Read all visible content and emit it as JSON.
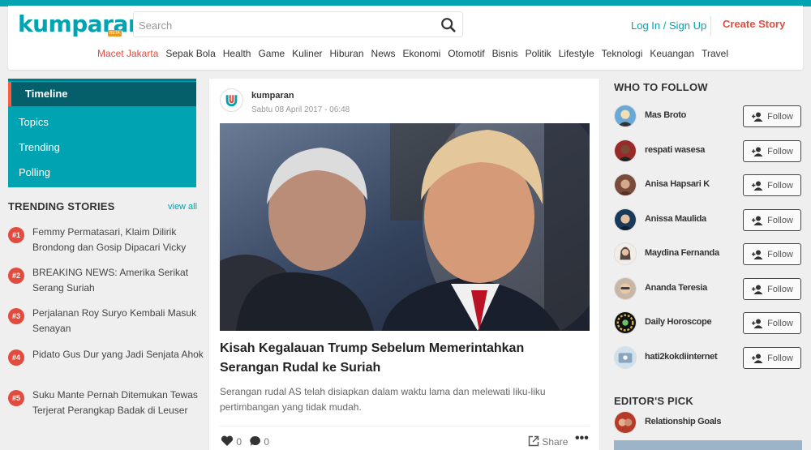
{
  "header": {
    "logo_text": "kumparan",
    "logo_badge": "BETA",
    "search_placeholder": "Search",
    "login_label": "Log In / Sign Up",
    "create_label": "Create Story",
    "categories": [
      "Macet Jakarta",
      "Sepak Bola",
      "Health",
      "Game",
      "Kuliner",
      "Hiburan",
      "News",
      "Ekonomi",
      "Otomotif",
      "Bisnis",
      "Politik",
      "Lifestyle",
      "Teknologi",
      "Keuangan",
      "Travel"
    ]
  },
  "sidebar": {
    "nav": [
      "Timeline",
      "Topics",
      "Trending",
      "Polling"
    ],
    "trending_title": "TRENDING STORIES",
    "view_all": "view all",
    "trending": [
      {
        "num": "#1",
        "text": "Femmy Permatasari, Klaim Dilirik Brondong dan Gosip Dipacari Vicky"
      },
      {
        "num": "#2",
        "text": "BREAKING NEWS: Amerika Serikat Serang Suriah"
      },
      {
        "num": "#3",
        "text": "Perjalanan Roy Suryo Kembali Masuk Senayan"
      },
      {
        "num": "#4",
        "text": "Pidato Gus Dur yang Jadi Senjata Ahok"
      },
      {
        "num": "#5",
        "text": "Suku Mante Pernah Ditemukan Tewas Terjerat Perangkap Badak di Leuser"
      }
    ]
  },
  "story": {
    "author": "kumparan",
    "date": "Sabtu 08 April 2017 - 06:48",
    "title": "Kisah Kegalauan Trump Sebelum Memerintahkan Serangan Rudal ke Suriah",
    "desc": "Serangan rudal AS telah disiapkan dalam waktu lama dan melewati liku-liku pertimbangan yang tidak mudah.",
    "likes": "0",
    "comments": "0",
    "share": "Share"
  },
  "right": {
    "follow_title": "WHO TO FOLLOW",
    "follow_label": "Follow",
    "users": [
      "Mas Broto",
      "respati wasesa",
      "Anisa Hapsari K",
      "Anissa Maulida",
      "Maydina Fernanda",
      "Ananda Teresia",
      "Daily Horoscope",
      "hati2kokdiinternet"
    ],
    "editors_title": "EDITOR'S PICK",
    "editor_pick": "Relationship Goals"
  },
  "colors": {
    "accent": "#00a3b1",
    "brand_red": "#e24c3f",
    "nav_active": "#045f6b"
  }
}
